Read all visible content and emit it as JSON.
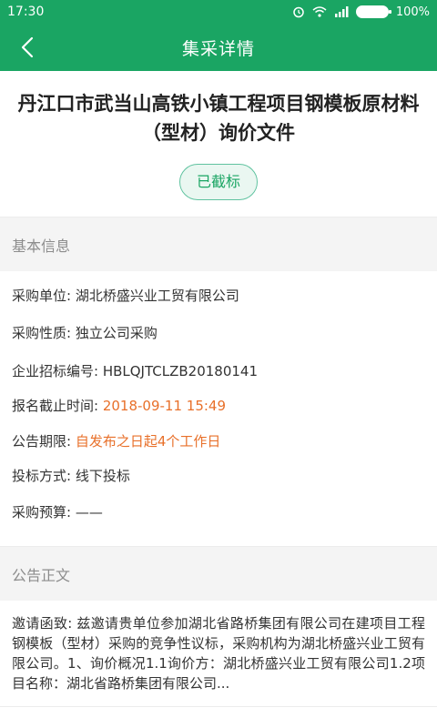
{
  "statusbar": {
    "time": "17:30",
    "battery": "100%",
    "icons": [
      "signal-icon",
      "wifi-icon",
      "alarm-icon",
      "battery-icon"
    ]
  },
  "navbar": {
    "title": "集采详情",
    "back_icon": "chevron-left-icon"
  },
  "header": {
    "title": "丹江口市武当山高铁小镇工程项目钢模板原材料（型材）询价文件",
    "status_badge": "已截标"
  },
  "basic_info": {
    "section_title": "基本信息",
    "rows": [
      {
        "label": "采购单位: ",
        "value": "湖北桥盛兴业工贸有限公司"
      },
      {
        "label": "采购性质: ",
        "value": "独立公司采购"
      },
      {
        "label": "企业招标编号: ",
        "value": "HBLQJTCLZB20180141"
      },
      {
        "label": "报名截止时间: ",
        "value": "2018-09-11 15:49"
      },
      {
        "label": "公告期限: ",
        "value": "自发布之日起4个工作日"
      },
      {
        "label": "投标方式: ",
        "value": "线下投标"
      },
      {
        "label": "采购预算: ",
        "value": "——"
      }
    ]
  },
  "notice": {
    "section_title": "公告正文",
    "text": "邀请函致: 兹邀请贵单位参加湖北省路桥集团有限公司在建项目工程钢模板（型材）采购的竞争性议标，采购机构为湖北桥盛兴业工贸有限公司。1、询价概况1.1询价方：湖北桥盛兴业工贸有限公司1.2项目名称：湖北省路桥集团有限公司..."
  },
  "colors": {
    "primary_green": "#1aa563",
    "highlight_orange": "#e8702a",
    "section_bg": "#f4f4f4"
  }
}
